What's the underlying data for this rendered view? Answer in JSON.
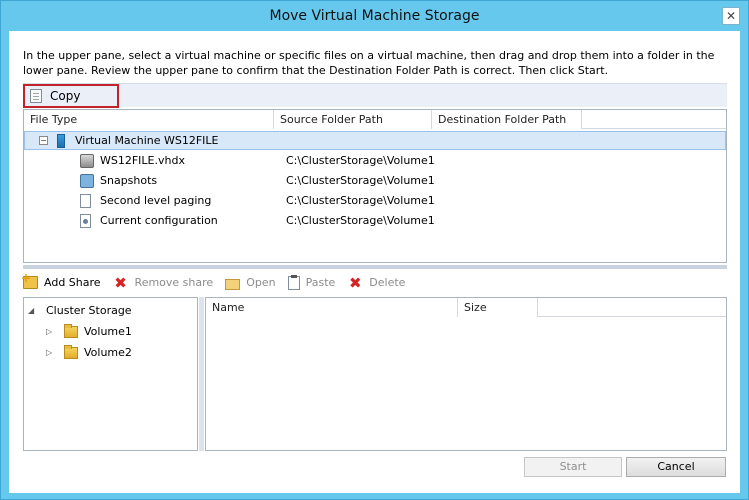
{
  "window": {
    "title": "Move Virtual Machine Storage",
    "close_glyph": "✕"
  },
  "instructions": "In the upper pane, select a virtual machine or specific files on a virtual machine, then drag and drop them into a folder in the lower pane.  Review the upper pane to confirm that the Destination Folder Path is correct. Then click Start.",
  "copy_button": {
    "label": "Copy",
    "icon": "document-icon",
    "highlight_color": "#c0242a"
  },
  "upper_table": {
    "columns": [
      "File Type",
      "Source Folder Path",
      "Destination Folder Path"
    ],
    "vm": {
      "label": "Virtual Machine WS12FILE",
      "expand_glyph": "−"
    },
    "rows": [
      {
        "name": "WS12FILE.vhdx",
        "source": "C:\\ClusterStorage\\Volume1",
        "icon": "disk-icon"
      },
      {
        "name": "Snapshots",
        "source": "C:\\ClusterStorage\\Volume1",
        "icon": "snapshot-icon"
      },
      {
        "name": "Second level paging",
        "source": "C:\\ClusterStorage\\Volume1",
        "icon": "page-icon"
      },
      {
        "name": "Current configuration",
        "source": "C:\\ClusterStorage\\Volume1",
        "icon": "config-icon"
      }
    ]
  },
  "toolbar": {
    "add_share": "Add Share",
    "remove_share": "Remove share",
    "open": "Open",
    "paste": "Paste",
    "delete": "Delete"
  },
  "folder_tree": {
    "root": "Cluster Storage",
    "children": [
      "Volume1",
      "Volume2"
    ]
  },
  "lower_table": {
    "columns": [
      "Name",
      "Size"
    ]
  },
  "buttons": {
    "start": "Start",
    "cancel": "Cancel"
  },
  "colors": {
    "title_bar": "#67c8ee",
    "selection": "#d8e8f9",
    "error_red": "#d62424"
  }
}
